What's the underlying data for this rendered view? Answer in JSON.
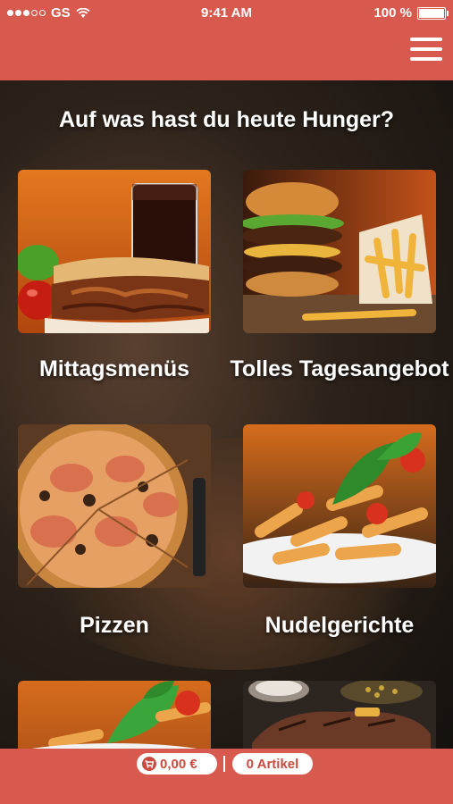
{
  "status_bar": {
    "carrier": "GS",
    "time": "9:41 AM",
    "battery": "100 %",
    "signal_icon": "signal-dots-icon",
    "wifi_icon": "wifi-icon",
    "battery_icon": "battery-icon"
  },
  "header": {
    "menu_icon": "hamburger-menu-icon",
    "brand_color": "#d85a4e"
  },
  "main": {
    "headline": "Auf was hast du heute Hunger?",
    "categories": [
      {
        "label": "Mittagsmenüs",
        "image": "doner-kebab-image"
      },
      {
        "label": "Tolles Tagesangebot",
        "image": "burger-fries-image"
      },
      {
        "label": "Pizzen",
        "image": "pizza-image"
      },
      {
        "label": "Nudelgerichte",
        "image": "penne-pasta-image"
      },
      {
        "label": "",
        "image": "pasta-basil-image"
      },
      {
        "label": "",
        "image": "steak-image"
      }
    ]
  },
  "footer": {
    "cart_icon": "cart-icon",
    "price": "0,00 €",
    "items": "0 Artikel"
  }
}
